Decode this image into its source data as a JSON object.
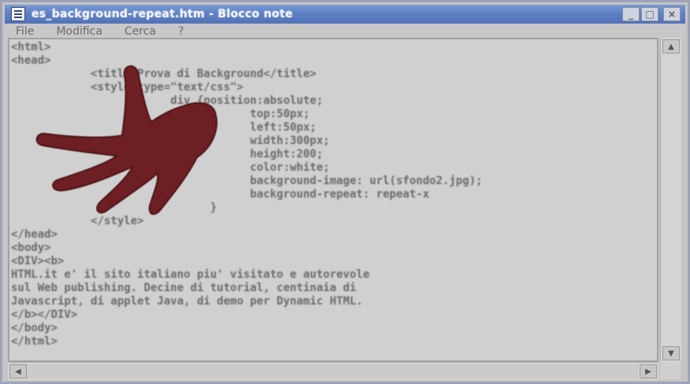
{
  "window": {
    "title": "es_background-repeat.htm - Blocco note",
    "buttons": {
      "minimize": "_",
      "maximize": "□",
      "close": "×"
    }
  },
  "menu": {
    "items": [
      "File",
      "Modifica",
      "Cerca",
      "?"
    ]
  },
  "editor": {
    "lines": [
      "<html>",
      "<head>",
      "            <title>Prova di Background</title>",
      "            <style type=\"text/css\">",
      "                        div {position:absolute;",
      "                                    top:50px;",
      "                                    left:50px;",
      "                                    width:300px;",
      "                                    height:200;",
      "                                    color:white;",
      "                                    background-image: url(sfondo2.jpg);",
      "                                    background-repeat: repeat-x",
      "                              }",
      "            </style>",
      "</head>",
      "<body>",
      "<DIV><b>",
      "HTML.it e' il sito italiano piu' visitato e autorevole",
      "sul Web publishing. Decine di tutorial, centinaia di",
      "Javascript, di applet Java, di demo per Dynamic HTML.",
      "</b></DIV>",
      "</body>",
      "</html>"
    ]
  },
  "colors": {
    "titlebar": "#5e80c4",
    "editor_bg": "#d0d0d0",
    "code_text": "#6a6a6a",
    "hand": "#6e1f24"
  },
  "icons": {
    "app": "notepad-icon",
    "scroll_up": "arrow-up-icon",
    "scroll_down": "arrow-down-icon",
    "scroll_left": "arrow-left-icon",
    "scroll_right": "arrow-right-icon",
    "hand": "hand-cursor-icon"
  }
}
